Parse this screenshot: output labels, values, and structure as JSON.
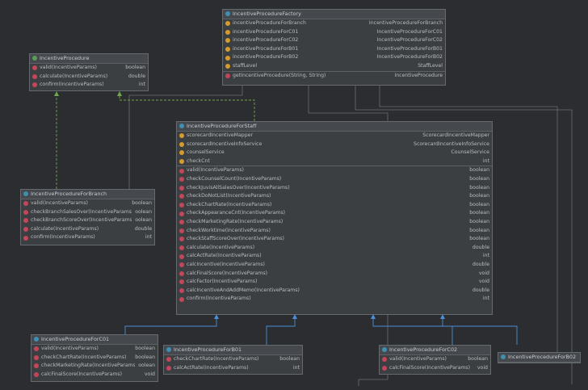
{
  "colors": {
    "background": "#2b2d30",
    "class_icon": "#3f8fb3",
    "interface_icon": "#5c9b5a",
    "field_icon": "#d79a2e",
    "method_icon": "#c3465a",
    "inheritance_arrow": "#4a8fd6",
    "implementation_arrow": "#6fa84a"
  },
  "boxes": {
    "factory": {
      "title": "IncentiveProcedureFactory",
      "kind": "class",
      "fields": [
        {
          "name": "incentiveProcedureForBranch",
          "type": "IncentiveProcedureForBranch"
        },
        {
          "name": "incentiveProcedureForC01",
          "type": "IncentiveProcedureForC01"
        },
        {
          "name": "incentiveProcedureForC02",
          "type": "IncentiveProcedureForC02"
        },
        {
          "name": "incentiveProcedureForB01",
          "type": "IncentiveProcedureForB01"
        },
        {
          "name": "incentiveProcedureForB02",
          "type": "IncentiveProcedureForB02"
        },
        {
          "name": "staffLevel",
          "type": "StaffLevel"
        }
      ],
      "methods": [
        {
          "name": "getIncentiveProcedure(String, String)",
          "type": "IncentiveProcedure"
        }
      ]
    },
    "iface": {
      "title": "IncentiveProcedure",
      "kind": "interface",
      "fields": [],
      "methods": [
        {
          "name": "valid(IncentiveParams)",
          "type": "boolean"
        },
        {
          "name": "calculate(IncentiveParams)",
          "type": "double"
        },
        {
          "name": "confirm(IncentiveParams)",
          "type": "int"
        }
      ]
    },
    "staff": {
      "title": "IncentiveProcedureForStaff",
      "kind": "class",
      "fields": [
        {
          "name": "scorecardIncentiveMapper",
          "type": "ScorecardIncentiveMapper"
        },
        {
          "name": "scorecardIncentiveInfoService",
          "type": "ScorecardIncentiveInfoService"
        },
        {
          "name": "counselService",
          "type": "CounselService"
        },
        {
          "name": "checkCnt",
          "type": "int"
        }
      ],
      "methods": [
        {
          "name": "valid(IncentiveParams)",
          "type": "boolean"
        },
        {
          "name": "checkCounselCount(IncentiveParams)",
          "type": "boolean"
        },
        {
          "name": "checkJuvisAllSalesOver(IncentiveParams)",
          "type": "boolean"
        },
        {
          "name": "checkDoNotList(IncentiveParams)",
          "type": "boolean"
        },
        {
          "name": "checkChartRate(IncentiveParams)",
          "type": "boolean"
        },
        {
          "name": "checkAppearanceCnt(IncentiveParams)",
          "type": "boolean"
        },
        {
          "name": "checkMarketingRate(IncentiveParams)",
          "type": "boolean"
        },
        {
          "name": "checkWorktime(IncentiveParams)",
          "type": "boolean"
        },
        {
          "name": "checkStaffScoreOver(IncentiveParams)",
          "type": "boolean"
        },
        {
          "name": "calculate(IncentiveParams)",
          "type": "double"
        },
        {
          "name": "calcActRate(IncentiveParams)",
          "type": "int"
        },
        {
          "name": "calcIncentive(IncentiveParams)",
          "type": "double"
        },
        {
          "name": "calcFinalScore(IncentiveParams)",
          "type": "void"
        },
        {
          "name": "calcFactor(IncentiveParams)",
          "type": "void"
        },
        {
          "name": "calcIncentiveAndAddMemo(IncentiveParams)",
          "type": "double"
        },
        {
          "name": "confirm(IncentiveParams)",
          "type": "int"
        }
      ]
    },
    "branch": {
      "title": "IncentiveProcedureForBranch",
      "kind": "class",
      "fields": [],
      "methods": [
        {
          "name": "valid(IncentiveParams)",
          "type": "boolean"
        },
        {
          "name": "checkBranchSalesOver(IncentiveParams)",
          "type": "oolean"
        },
        {
          "name": "checkBranchScoreOver(IncentiveParams)",
          "type": "oolean"
        },
        {
          "name": "calculate(IncentiveParams)",
          "type": "double"
        },
        {
          "name": "confirm(IncentiveParams)",
          "type": "int"
        }
      ]
    },
    "c01": {
      "title": "IncentiveProcedureForC01",
      "kind": "class",
      "fields": [],
      "methods": [
        {
          "name": "valid(IncentiveParams)",
          "type": "boolean"
        },
        {
          "name": "checkChartRate(IncentiveParams)",
          "type": "boolean"
        },
        {
          "name": "checkMarketingRate(IncentiveParams)",
          "type": "oolean"
        },
        {
          "name": "calcFinalScore(IncentiveParams)",
          "type": "void"
        }
      ]
    },
    "b01": {
      "title": "IncentiveProcedureForB01",
      "kind": "class",
      "fields": [],
      "methods": [
        {
          "name": "checkChartRate(IncentiveParams)",
          "type": "boolean"
        },
        {
          "name": "calcActRate(IncentiveParams)",
          "type": "int"
        }
      ]
    },
    "c02": {
      "title": "IncentiveProcedureForC02",
      "kind": "class",
      "fields": [],
      "methods": [
        {
          "name": "valid(IncentiveParams)",
          "type": "boolean"
        },
        {
          "name": "calcFinalScore(IncentiveParams)",
          "type": "void"
        }
      ]
    },
    "b02": {
      "title": "IncentiveProcedureForB02",
      "kind": "class",
      "fields": [],
      "methods": []
    }
  }
}
